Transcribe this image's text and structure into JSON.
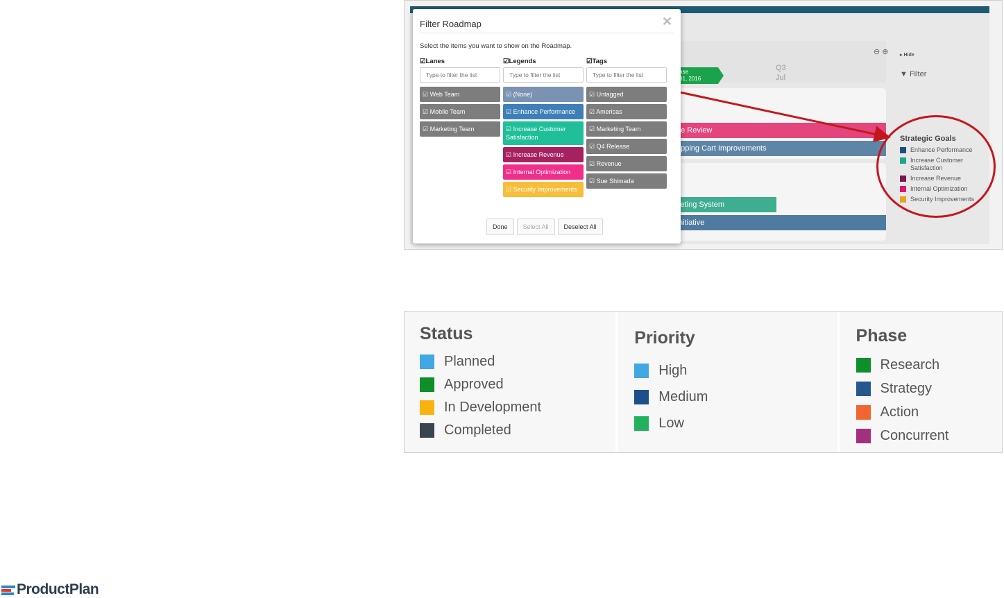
{
  "roadmap": {
    "header": {
      "q3": "Q3",
      "month": "Jul",
      "release_name": "ase",
      "release_date": "31, 2016"
    },
    "bars": [
      {
        "label": "de Review",
        "color": "#e3457c"
      },
      {
        "label": "opping Cart Improvements",
        "color": "#5e85a6"
      },
      {
        "label": "keting System",
        "color": "#3fad8f"
      },
      {
        "label": "Initiative",
        "color": "#4f7ba3"
      }
    ],
    "controls": {
      "icons": "⊖ ⊕",
      "hide": "▸ Hide",
      "filter": "Filter"
    },
    "legend": {
      "title": "Strategic Goals",
      "items": [
        {
          "label": "Enhance Performance",
          "color": "#1f4e7e"
        },
        {
          "label": "Increase Customer Satisfaction",
          "color": "#1ca68a"
        },
        {
          "label": "Increase Revenue",
          "color": "#7a1a4a"
        },
        {
          "label": "Internal Optimization",
          "color": "#e0166a"
        },
        {
          "label": "Security Improvements",
          "color": "#e8a21c"
        }
      ]
    }
  },
  "modal": {
    "title": "Filter Roadmap",
    "close": "✕",
    "description": "Select the items you want to show on the Roadmap.",
    "columns": [
      {
        "heading": "☑Lanes",
        "placeholder": "Type to filter the list",
        "chips": [
          {
            "label": "☑ Web Team",
            "color": "#7d7d7d"
          },
          {
            "label": "☑ Mobile Team",
            "color": "#7d7d7d"
          },
          {
            "label": "☑ Marketing Team",
            "color": "#7d7d7d"
          }
        ]
      },
      {
        "heading": "☑Legends",
        "placeholder": "Type to filter the list",
        "chips": [
          {
            "label": "☑ (None)",
            "color": "#7a93b3"
          },
          {
            "label": "☑ Enhance Performance",
            "color": "#3e7fb8"
          },
          {
            "label": "☑ Increase Customer Satisfaction",
            "color": "#1fbf9a"
          },
          {
            "label": "☑ Increase Revenue",
            "color": "#a6215f"
          },
          {
            "label": "☑ Internal Optimization",
            "color": "#f02f8a"
          },
          {
            "label": "☑ Security Improvements",
            "color": "#f7be3a"
          }
        ]
      },
      {
        "heading": "☑Tags",
        "placeholder": "Type to filter the list",
        "chips": [
          {
            "label": "☑ Untagged",
            "color": "#7d7d7d"
          },
          {
            "label": "☑ Americas",
            "color": "#7d7d7d"
          },
          {
            "label": "☑ Marketing Team",
            "color": "#7d7d7d"
          },
          {
            "label": "☑ Q4 Release",
            "color": "#7d7d7d"
          },
          {
            "label": "☑ Revenue",
            "color": "#7d7d7d"
          },
          {
            "label": "☑ Sue Shimada",
            "color": "#7d7d7d"
          }
        ]
      }
    ],
    "buttons": {
      "done": "Done",
      "select_all": "Select All",
      "deselect_all": "Deselect All"
    }
  },
  "legend_panel": {
    "groups": [
      {
        "title": "Status",
        "items": [
          {
            "label": "Planned",
            "color": "#41a8e3"
          },
          {
            "label": "Approved",
            "color": "#0f8f2a"
          },
          {
            "label": "In Development",
            "color": "#f9b20f"
          },
          {
            "label": "Completed",
            "color": "#3a4550"
          }
        ]
      },
      {
        "title": "Priority",
        "items": [
          {
            "label": "High",
            "color": "#41a8e3"
          },
          {
            "label": "Medium",
            "color": "#1c4f8c"
          },
          {
            "label": "Low",
            "color": "#22b15c"
          }
        ]
      },
      {
        "title": "Phase",
        "items": [
          {
            "label": "Research",
            "color": "#0f8f2a"
          },
          {
            "label": "Strategy",
            "color": "#25588f"
          },
          {
            "label": "Action",
            "color": "#f06530"
          },
          {
            "label": "Concurrent",
            "color": "#a3307f"
          }
        ]
      }
    ]
  },
  "logo": {
    "text": "ProductPlan"
  }
}
